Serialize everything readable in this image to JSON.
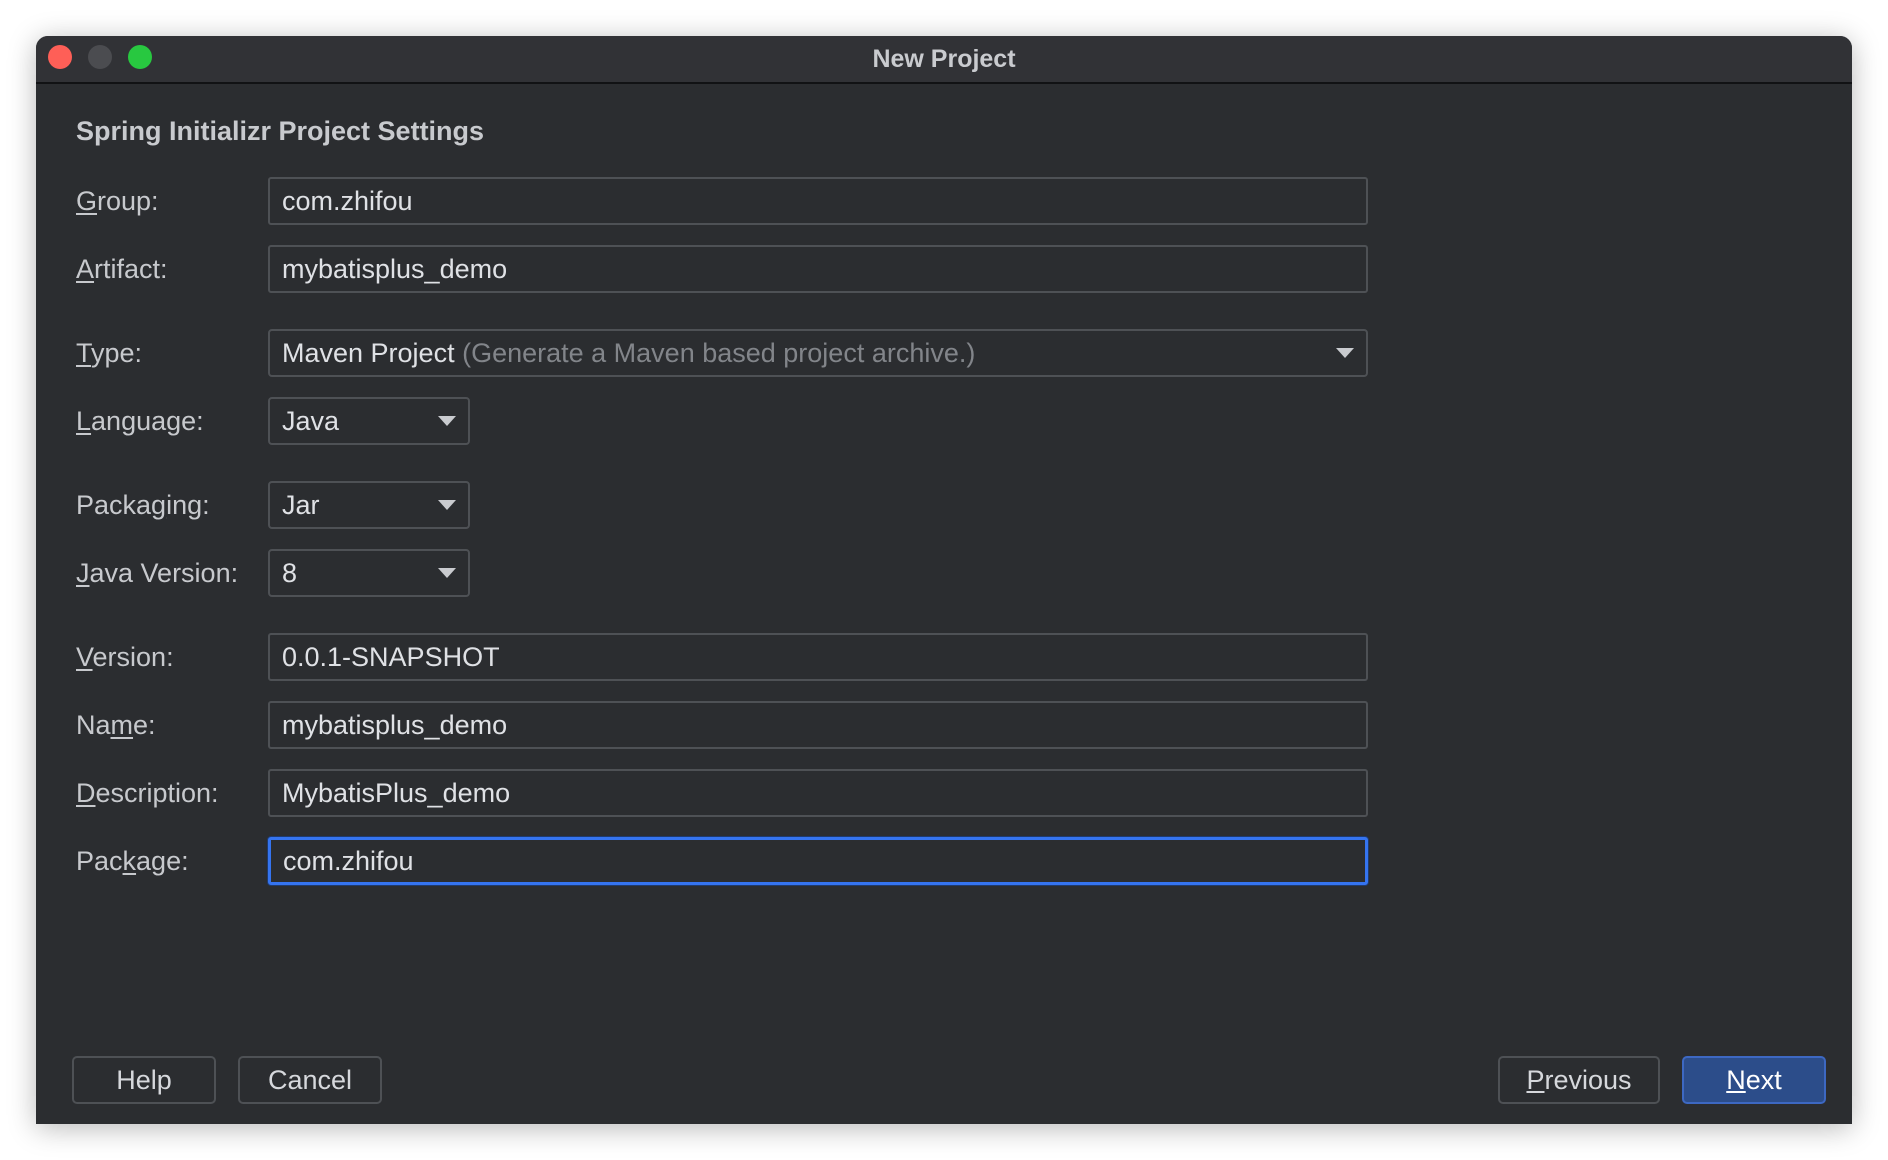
{
  "window": {
    "title": "New Project"
  },
  "section": {
    "title": "Spring Initializr Project Settings"
  },
  "form": {
    "group": {
      "label": "Group:",
      "value": "com.zhifou"
    },
    "artifact": {
      "label": "Artifact:",
      "value": "mybatisplus_demo"
    },
    "type": {
      "label": "Type:",
      "value": "Maven Project",
      "hint": "(Generate a Maven based project archive.)"
    },
    "language": {
      "label": "Language:",
      "value": "Java"
    },
    "packaging": {
      "label": "Packaging:",
      "value": "Jar"
    },
    "java_version": {
      "label": "Java Version:",
      "value": "8"
    },
    "version": {
      "label": "Version:",
      "value": "0.0.1-SNAPSHOT"
    },
    "name": {
      "label": "Name:",
      "value": "mybatisplus_demo"
    },
    "description": {
      "label": "Description:",
      "value": "MybatisPlus_demo"
    },
    "package": {
      "label": "Package:",
      "value": "com.zhifou"
    }
  },
  "buttons": {
    "help": "Help",
    "cancel": "Cancel",
    "previous": "Previous",
    "next": "Next"
  },
  "colors": {
    "background": "#2b2d30",
    "accent": "#3574f0",
    "primary_button": "#2c4d8a"
  }
}
